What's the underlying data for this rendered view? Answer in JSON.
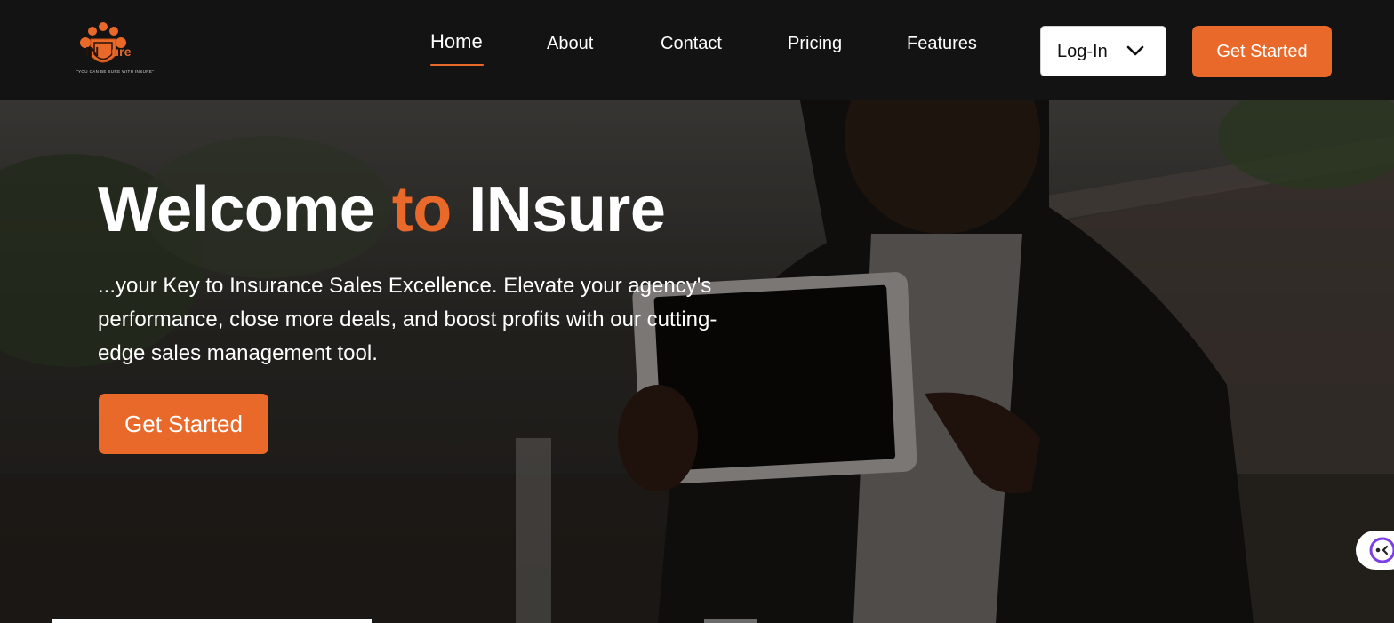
{
  "brand": {
    "name_prefix": "IN",
    "name_suffix": "sure",
    "tagline": "\"YOU CAN BE SURE WITH INSURE\""
  },
  "nav": {
    "links": [
      "Home",
      "About",
      "Contact",
      "Pricing",
      "Features"
    ],
    "active": "Home",
    "login_label": "Log-In",
    "cta_label": "Get Started"
  },
  "hero": {
    "title_part1": "Welcome ",
    "title_accent": "to",
    "title_part2": " INsure",
    "subtitle": "...your Key to Insurance Sales Excellence. Elevate your agency's performance, close more deals, and boost profits with our cutting-edge sales management tool.",
    "cta_label": "Get Started"
  },
  "colors": {
    "accent": "#e8692a",
    "navbar_bg": "#131313",
    "text_light": "#ffffff"
  },
  "icons": {
    "logo": "paw-shield-logo",
    "login_chevron": "chevron-down-icon",
    "chat": "chat-bot-icon"
  }
}
